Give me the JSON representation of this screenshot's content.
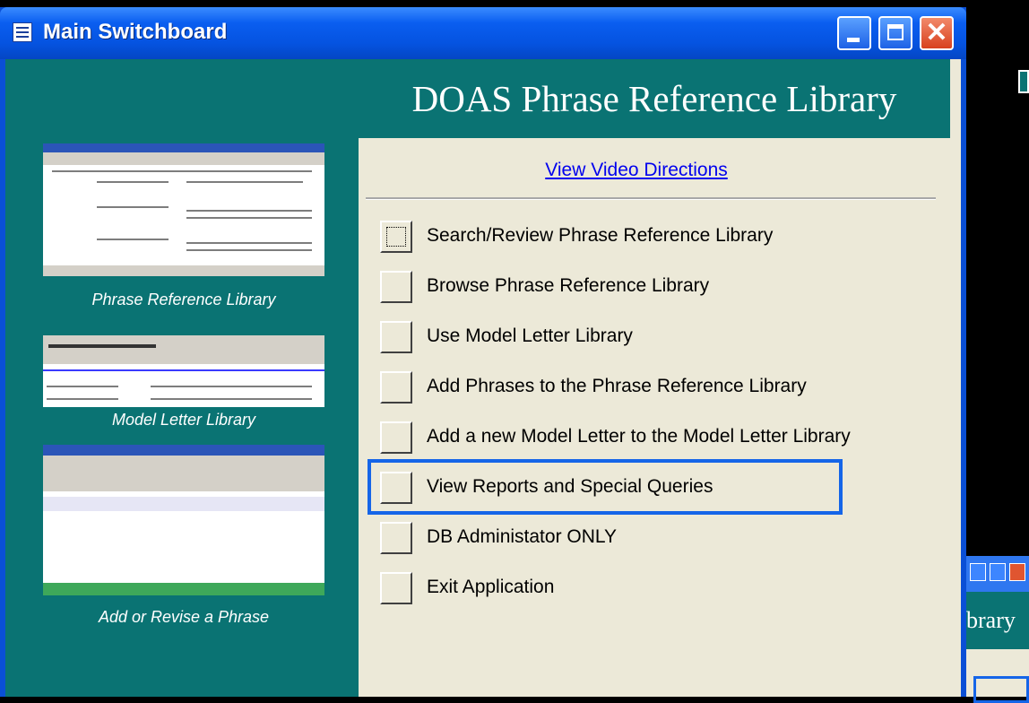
{
  "window": {
    "title": "Main Switchboard",
    "heading": "DOAS Phrase Reference Library"
  },
  "titlebar_buttons": [
    "minimize",
    "maximize",
    "close"
  ],
  "video_link": "View Video Directions",
  "menu_items": [
    {
      "label": "Search/Review Phrase Reference Library",
      "focused": true
    },
    {
      "label": "Browse Phrase Reference Library"
    },
    {
      "label": "Use Model Letter Library"
    },
    {
      "label": "Add Phrases to the Phrase Reference Library"
    },
    {
      "label": "Add a new Model Letter to the Model Letter Library"
    },
    {
      "label": "View Reports and Special Queries",
      "highlighted": true
    },
    {
      "label": "DB Administator ONLY"
    },
    {
      "label": "Exit Application"
    }
  ],
  "thumbnails": [
    {
      "caption": "Phrase Reference Library"
    },
    {
      "caption": "Model Letter Library"
    },
    {
      "caption": "Add or Revise a Phrase"
    }
  ],
  "background_window": {
    "heading_fragment": "brary"
  },
  "colors": {
    "teal": "#0a7373",
    "panel": "#ece9d8",
    "title_blue": "#0a5ef0",
    "highlight_blue": "#1565e8",
    "link": "#0000ee"
  }
}
